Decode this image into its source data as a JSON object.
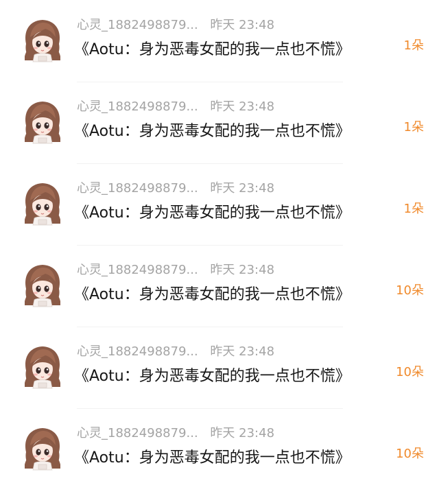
{
  "gift_list": {
    "items": [
      {
        "user": "心灵_1882498879...",
        "time": "昨天 23:48",
        "title": "《Aotu：身为恶毒女配的我一点也不慌》",
        "gift": "1朵"
      },
      {
        "user": "心灵_1882498879...",
        "time": "昨天 23:48",
        "title": "《Aotu：身为恶毒女配的我一点也不慌》",
        "gift": "1朵"
      },
      {
        "user": "心灵_1882498879...",
        "time": "昨天 23:48",
        "title": "《Aotu：身为恶毒女配的我一点也不慌》",
        "gift": "1朵"
      },
      {
        "user": "心灵_1882498879...",
        "time": "昨天 23:48",
        "title": "《Aotu：身为恶毒女配的我一点也不慌》",
        "gift": "10朵"
      },
      {
        "user": "心灵_1882498879...",
        "time": "昨天 23:48",
        "title": "《Aotu：身为恶毒女配的我一点也不慌》",
        "gift": "10朵"
      },
      {
        "user": "心灵_1882498879...",
        "time": "昨天 23:48",
        "title": "《Aotu：身为恶毒女配的我一点也不慌》",
        "gift": "10朵"
      }
    ]
  },
  "colors": {
    "meta_text": "#a4a4a4",
    "title_text": "#161616",
    "gift_accent": "#f08a2c",
    "divider": "#f2f2f2"
  },
  "icons": {
    "avatar": "chibi-girl-avatar"
  }
}
